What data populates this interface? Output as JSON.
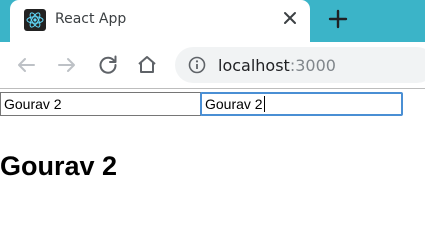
{
  "browser": {
    "tab": {
      "title": "React App",
      "favicon": "react-logo-icon"
    },
    "new_tab_icon": "plus-icon",
    "toolbar": {
      "back_icon": "back-arrow-icon",
      "forward_icon": "forward-arrow-icon",
      "reload_icon": "reload-icon",
      "home_icon": "home-icon",
      "info_icon": "info-icon",
      "url_host": "localhost",
      "url_port": ":3000"
    }
  },
  "page": {
    "input_1_value": "Gourav 2",
    "input_2_value": "Gourav 2",
    "heading": "Gourav 2"
  },
  "colors": {
    "tabstrip": "#3bb4c8",
    "focus_border": "#4a8fd4"
  }
}
